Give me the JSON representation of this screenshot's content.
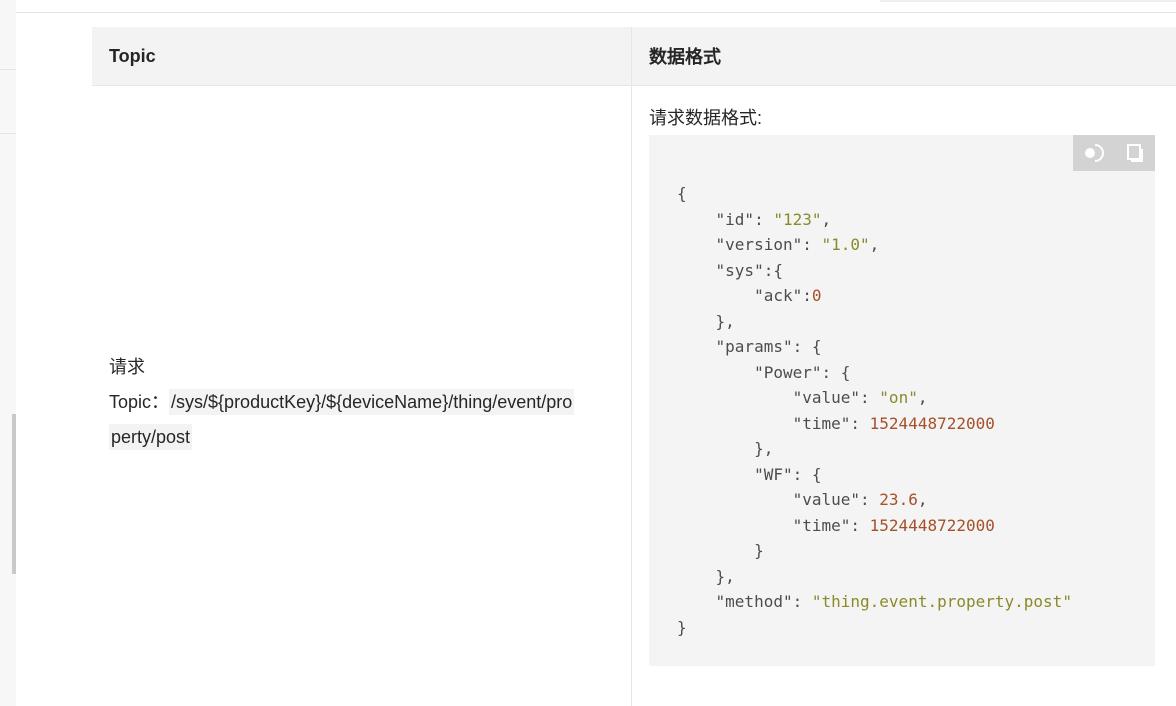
{
  "table": {
    "headers": {
      "topic": "Topic",
      "format": "数据格式"
    },
    "request": {
      "label": "请求",
      "topic_prefix": "Topic：",
      "topic_path_line1": "/sys/${productKey}/${deviceName}/thing/event/pro",
      "topic_path_line2": "perty/post"
    },
    "format_label": "请求数据格式:"
  },
  "code": {
    "tools": [
      {
        "name": "theme-toggle-icon"
      },
      {
        "name": "copy-icon"
      }
    ],
    "lines": {
      "open": "{",
      "id_key": "\"id\"",
      "id_val": "\"123\"",
      "version_key": "\"version\"",
      "version_val": "\"1.0\"",
      "sys_key": "\"sys\"",
      "ack_key": "\"ack\"",
      "ack_val": "0",
      "params_key": "\"params\"",
      "power_key": "\"Power\"",
      "power_value_key": "\"value\"",
      "power_value_val": "\"on\"",
      "power_time_key": "\"time\"",
      "power_time_val": "1524448722000",
      "wf_key": "\"WF\"",
      "wf_value_key": "\"value\"",
      "wf_value_val": "23.6",
      "wf_time_key": "\"time\"",
      "wf_time_val": "1524448722000",
      "method_key": "\"method\"",
      "method_val": "\"thing.event.property.post\"",
      "close": "}"
    }
  },
  "colors": {
    "string": "#8a8a2a",
    "number": "#a4512a",
    "header_bg": "#f3f3f3",
    "code_bg": "#f4f4f4"
  }
}
